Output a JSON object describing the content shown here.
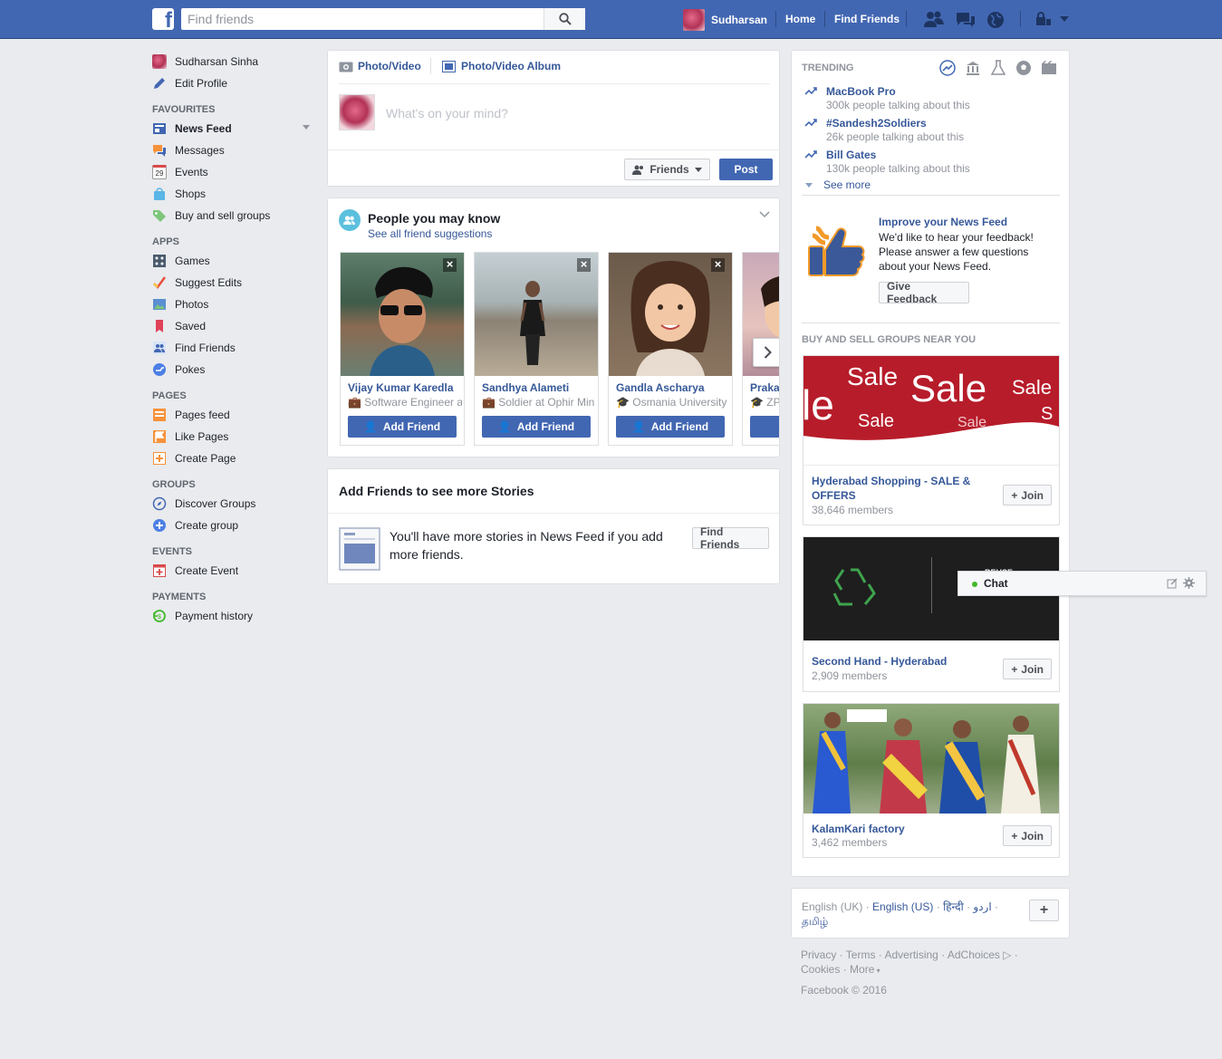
{
  "topbar": {
    "search_placeholder": "Find friends",
    "user": "Sudharsan",
    "home": "Home",
    "find_friends": "Find Friends"
  },
  "sidebar": {
    "user": "Sudharsan Sinha",
    "edit": "Edit Profile",
    "favourites_h": "FAVOURITES",
    "news_feed": "News Feed",
    "messages": "Messages",
    "events": "Events",
    "shops": "Shops",
    "buysell": "Buy and sell groups",
    "apps_h": "APPS",
    "games": "Games",
    "suggest": "Suggest Edits",
    "photos": "Photos",
    "saved": "Saved",
    "findfriends": "Find Friends",
    "pokes": "Pokes",
    "pages_h": "PAGES",
    "pagesfeed": "Pages feed",
    "likepages": "Like Pages",
    "createpage": "Create Page",
    "groups_h": "GROUPS",
    "discover": "Discover Groups",
    "creategroup": "Create group",
    "events_h": "EVENTS",
    "createevent": "Create Event",
    "payments_h": "PAYMENTS",
    "payhist": "Payment history",
    "events_icon_num": "29"
  },
  "composer": {
    "photo_video": "Photo/Video",
    "album": "Photo/Video Album",
    "placeholder": "What's on your mind?",
    "audience": "Friends",
    "post": "Post"
  },
  "pymk": {
    "title": "People you may know",
    "see_all": "See all friend suggestions",
    "add": "Add Friend",
    "people": [
      {
        "name": "Vijay Kumar Karedla",
        "sub": "Software Engineer at"
      },
      {
        "name": "Sandhya Alameti",
        "sub": "Soldier at Ophir Min"
      },
      {
        "name": "Gandla Ascharya",
        "sub": "Osmania University"
      },
      {
        "name": "Praka",
        "sub": "ZP"
      }
    ]
  },
  "stories": {
    "title": "Add Friends to see more Stories",
    "text": "You'll have more stories in News Feed if you add more friends.",
    "btn": "Find Friends"
  },
  "trending": {
    "title": "TRENDING",
    "items": [
      {
        "name": "MacBook Pro",
        "sub": "300k people talking about this"
      },
      {
        "name": "#Sandesh2Soldiers",
        "sub": "26k people talking about this"
      },
      {
        "name": "Bill Gates",
        "sub": "130k people talking about this"
      }
    ],
    "see_more": "See more"
  },
  "feedback": {
    "title": "Improve your News Feed",
    "text": "We'd like to hear your feedback! Please answer a few questions about your News Feed.",
    "btn": "Give Feedback"
  },
  "groups": {
    "title": "BUY AND SELL GROUPS NEAR YOU",
    "join": "Join",
    "items": [
      {
        "name": "Hyderabad Shopping - SALE & OFFERS",
        "members": "38,646 members"
      },
      {
        "name": "Second Hand - Hyderabad",
        "members": "2,909 members"
      },
      {
        "name": "KalamKari factory",
        "members": "3,462 members"
      }
    ],
    "sale_words": [
      "Sale",
      "Sale",
      "Sale",
      "le",
      "Sale",
      "Sale",
      "S"
    ],
    "reuse": "REUSE"
  },
  "lang": {
    "uk": "English (UK)",
    "us": "English (US)",
    "hi": "हिन्दी",
    "ur": "اردو",
    "ta": "தமிழ்"
  },
  "footer": {
    "privacy": "Privacy",
    "terms": "Terms",
    "advertising": "Advertising",
    "adchoices": "AdChoices",
    "cookies": "Cookies",
    "more": "More",
    "copyright": "Facebook © 2016"
  },
  "chat": {
    "label": "Chat"
  },
  "colors": {
    "brand": "#4267b2",
    "link": "#365899",
    "muted": "#90949c"
  }
}
